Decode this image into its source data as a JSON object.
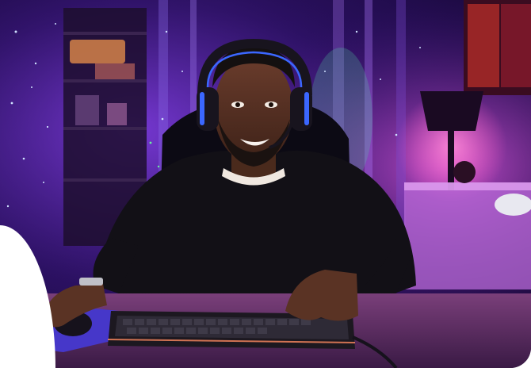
{
  "scene": {
    "subject": "person",
    "colors": {
      "wall_purple": "#4b1d9a",
      "light_magenta": "#d04bd8",
      "desk": "#5a2f60",
      "shirt": "#121016",
      "skin": "#5a3324",
      "headset_accent": "#3b67ff",
      "mousepad": "#4637c9"
    }
  }
}
